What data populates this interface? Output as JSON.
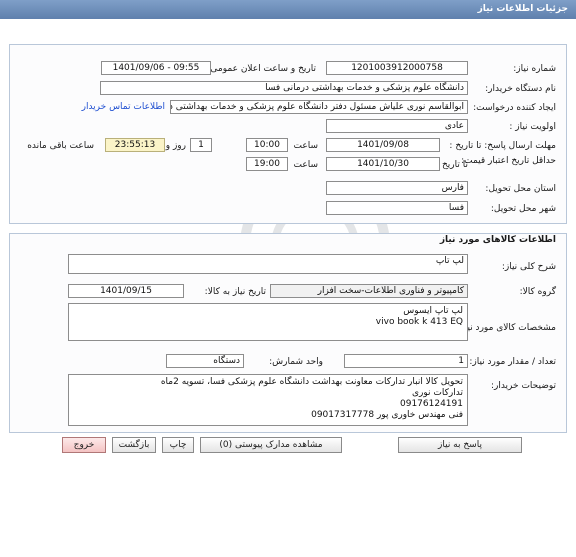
{
  "window": {
    "title": "جزئیات اطلاعات نیاز"
  },
  "labels": {
    "need_number": "شماره نیاز:",
    "announce_datetime": "تاریخ و ساعت اعلان عمومی:",
    "buyer_org": "نام دستگاه خریدار:",
    "requester": "ایجاد کننده درخواست:",
    "priority": "اولویت نیاز :",
    "deadline_send": "مهلت ارسال پاسخ: تا تاریخ :",
    "min_validity": "حداقل تاریخ اعتبار قیمت:",
    "until_date": "تا تاریخ :",
    "time": "ساعت",
    "time2": "ساعت",
    "days_and": "روز و",
    "remaining": "ساعت باقی مانده",
    "province": "استان محل تحویل:",
    "city": "شهر محل تحویل:",
    "goods_section": "اطلاعات کالاهای مورد نیاز",
    "general_desc": "شرح کلی نیاز:",
    "goods_group": "گروه کالا:",
    "need_date": "تاریخ نیاز به کالا:",
    "goods_spec": "مشخصات کالای مورد نیاز:",
    "quantity": "تعداد / مقدار مورد نیاز:",
    "unit": "واحد شمارش:",
    "buyer_notes": "توضیحات خریدار:"
  },
  "fields": {
    "need_number": "1201003912000758",
    "announce_datetime": "1401/09/06 - 09:55",
    "buyer_org": "دانشگاه علوم پزشکی و خدمات بهداشتی درمانی فسا",
    "requester": "ابوالقاسم نوری علیاش مسئول دفتر دانشگاه علوم پزشکی و خدمات بهداشتی د",
    "contact_link": "اطلاعات تماس خریدار",
    "priority": "عادی",
    "deadline_date": "1401/09/08",
    "deadline_time": "10:00",
    "days": "1",
    "remaining_time": "23:55:13",
    "validity_date": "1401/10/30",
    "validity_time": "19:00",
    "province": "فارس",
    "city": "فسا",
    "general_desc": "لپ تاپ",
    "goods_group": "کامپیوتر و فناوری اطلاعات-سخت افزار",
    "need_date": "1401/09/15",
    "goods_spec_lines": [
      "لپ تاپ ایسوس",
      "vivo book k 413 EQ"
    ],
    "quantity": "1",
    "unit": "دستگاه",
    "buyer_notes_lines": [
      "تحویل کالا انبار تدارکات معاونت بهداشت دانشگاه علوم پزشکی فسا، تسویه 2ماه",
      "تدارکات نوری",
      "09176124191",
      "فنی مهندس خاوری پور          09017317778"
    ]
  },
  "buttons": {
    "reply": "پاسخ به نیاز",
    "attachments": "مشاهده مدارک پیوستی (0)",
    "print": "چاپ",
    "back": "بازگشت",
    "exit": "خروج"
  }
}
